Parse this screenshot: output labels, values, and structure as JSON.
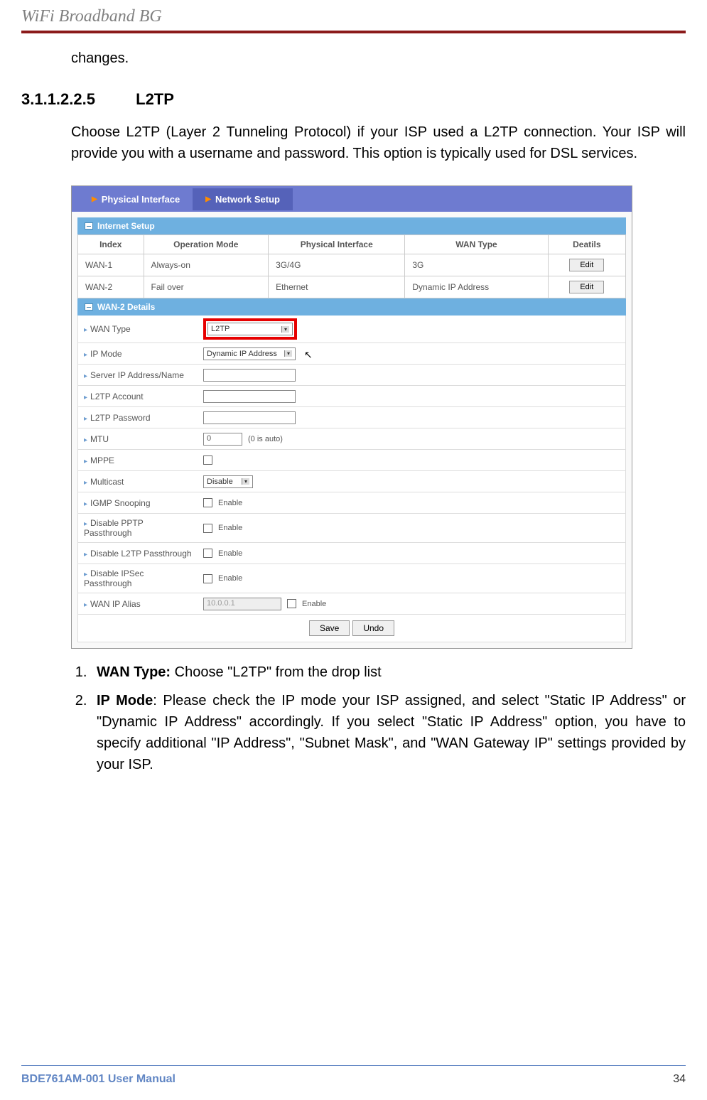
{
  "header": {
    "title": "WiFi Broadband BG"
  },
  "prev_line": "changes.",
  "section": {
    "num": "3.1.1.2.2.5",
    "title": "L2TP"
  },
  "intro": "Choose L2TP (Layer 2 Tunneling Protocol) if your ISP used a L2TP connection. Your ISP will provide you with a username and password. This option is typically used for DSL services.",
  "tabs": {
    "physical": "Physical Interface",
    "network": "Network Setup"
  },
  "internet_setup": {
    "banner": "Internet Setup",
    "headers": {
      "index": "Index",
      "op": "Operation Mode",
      "pi": "Physical Interface",
      "wan": "WAN Type",
      "det": "Deatils"
    },
    "rows": [
      {
        "index": "WAN-1",
        "op": "Always-on",
        "pi": "3G/4G",
        "wan": "3G",
        "btn": "Edit"
      },
      {
        "index": "WAN-2",
        "op": "Fail over",
        "pi": "Ethernet",
        "wan": "Dynamic IP Address",
        "btn": "Edit"
      }
    ]
  },
  "details": {
    "banner": "WAN-2 Details",
    "wan_type": {
      "label": "WAN Type",
      "value": "L2TP"
    },
    "ip_mode": {
      "label": "IP Mode",
      "value": "Dynamic IP Address"
    },
    "server": {
      "label": "Server IP Address/Name"
    },
    "account": {
      "label": "L2TP Account"
    },
    "password": {
      "label": "L2TP Password"
    },
    "mtu": {
      "label": "MTU",
      "value": "0",
      "hint": "(0 is auto)"
    },
    "mppe": {
      "label": "MPPE"
    },
    "multicast": {
      "label": "Multicast",
      "value": "Disable"
    },
    "igmp": {
      "label": "IGMP Snooping",
      "opt": "Enable"
    },
    "pptp": {
      "label": "Disable PPTP Passthrough",
      "opt": "Enable"
    },
    "l2tp": {
      "label": "Disable L2TP Passthrough",
      "opt": "Enable"
    },
    "ipsec": {
      "label": "Disable IPSec Passthrough",
      "opt": "Enable"
    },
    "alias": {
      "label": "WAN IP Alias",
      "value": "10.0.0.1",
      "opt": "Enable"
    },
    "save": "Save",
    "undo": "Undo"
  },
  "list": {
    "item1_bold": "WAN Type:",
    "item1_rest": " Choose \"L2TP\" from the drop list",
    "item2_bold": "IP Mode",
    "item2_rest": ": Please check the IP mode your ISP assigned, and select \"Static IP Address\" or \"Dynamic IP Address\" accordingly. If you select \"Static IP Address\" option, you have to specify additional \"IP Address\", \"Subnet Mask\", and \"WAN Gateway IP\" settings provided by your ISP."
  },
  "footer": {
    "left": "BDE761AM-001    User Manual",
    "page": "34"
  }
}
